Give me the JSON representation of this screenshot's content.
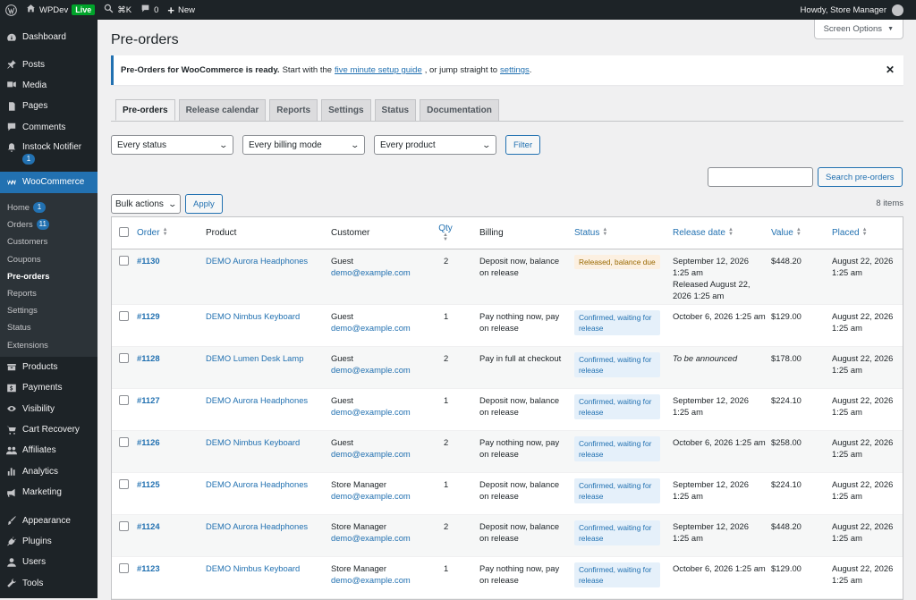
{
  "adminbar": {
    "site_name": "WPDev",
    "live_label": "Live",
    "search_shortcut": "⌘K",
    "comments_count": "0",
    "new_label": "New",
    "howdy": "Howdy, Store Manager"
  },
  "sidebar": {
    "top_items": [
      {
        "label": "Dashboard",
        "icon": "dashboard-icon"
      },
      {
        "label": "Posts",
        "icon": "pin-icon"
      },
      {
        "label": "Media",
        "icon": "media-icon"
      },
      {
        "label": "Pages",
        "icon": "pages-icon"
      },
      {
        "label": "Comments",
        "icon": "comments-icon"
      }
    ],
    "instock": {
      "label": "Instock Notifier",
      "badge": "1"
    },
    "woocommerce": {
      "label": "WooCommerce"
    },
    "sub_items": [
      {
        "label": "Home",
        "badge": "1"
      },
      {
        "label": "Orders",
        "badge": "11"
      },
      {
        "label": "Customers"
      },
      {
        "label": "Coupons"
      },
      {
        "label": "Pre-orders",
        "active": true
      },
      {
        "label": "Reports"
      },
      {
        "label": "Settings"
      },
      {
        "label": "Status"
      },
      {
        "label": "Extensions"
      }
    ],
    "bottom_items": [
      {
        "label": "Products"
      },
      {
        "label": "Payments"
      },
      {
        "label": "Visibility"
      },
      {
        "label": "Cart Recovery"
      },
      {
        "label": "Affiliates"
      },
      {
        "label": "Analytics"
      },
      {
        "label": "Marketing"
      },
      {
        "label": "Appearance"
      },
      {
        "label": "Plugins"
      },
      {
        "label": "Users"
      },
      {
        "label": "Tools"
      }
    ]
  },
  "screen_options": "Screen Options",
  "page_title": "Pre-orders",
  "notice": {
    "bold": "Pre-Orders for WooCommerce is ready.",
    "text1": "Start with the",
    "link1": "five minute setup guide",
    "text2": ", or jump straight to",
    "link2": "settings",
    "text3": "."
  },
  "tabs": [
    "Pre-orders",
    "Release calendar",
    "Reports",
    "Settings",
    "Status",
    "Documentation"
  ],
  "filters": {
    "status": "Every status",
    "billing": "Every billing mode",
    "product": "Every product",
    "filter_button": "Filter"
  },
  "search_button": "Search pre-orders",
  "bulk": {
    "label": "Bulk actions",
    "apply": "Apply"
  },
  "items_count": "8 items",
  "columns": {
    "order": "Order",
    "product": "Product",
    "customer": "Customer",
    "qty": "Qty",
    "billing": "Billing",
    "status": "Status",
    "release": "Release date",
    "value": "Value",
    "placed": "Placed"
  },
  "rows": [
    {
      "order": "#1130",
      "product": "DEMO Aurora Headphones",
      "customer": "Guest",
      "email": "demo@example.com",
      "qty": "2",
      "billing": "Deposit now, balance on release",
      "status": "Released, balance due",
      "status_type": "released",
      "release": "September 12, 2026 1:25 am",
      "release_note": "Released August 22, 2026 1:25 am",
      "value": "$448.20",
      "placed": "August 22, 2026 1:25 am"
    },
    {
      "order": "#1129",
      "product": "DEMO Nimbus Keyboard",
      "customer": "Guest",
      "email": "demo@example.com",
      "qty": "1",
      "billing": "Pay nothing now, pay on release",
      "status": "Confirmed, waiting for release",
      "status_type": "confirmed",
      "release": "October 6, 2026 1:25 am",
      "release_note": "",
      "value": "$129.00",
      "placed": "August 22, 2026 1:25 am"
    },
    {
      "order": "#1128",
      "product": "DEMO Lumen Desk Lamp",
      "customer": "Guest",
      "email": "demo@example.com",
      "qty": "2",
      "billing": "Pay in full at checkout",
      "status": "Confirmed, waiting for release",
      "status_type": "confirmed",
      "release": "To be announced",
      "release_note": "",
      "value": "$178.00",
      "placed": "August 22, 2026 1:25 am"
    },
    {
      "order": "#1127",
      "product": "DEMO Aurora Headphones",
      "customer": "Guest",
      "email": "demo@example.com",
      "qty": "1",
      "billing": "Deposit now, balance on release",
      "status": "Confirmed, waiting for release",
      "status_type": "confirmed",
      "release": "September 12, 2026 1:25 am",
      "release_note": "",
      "value": "$224.10",
      "placed": "August 22, 2026 1:25 am"
    },
    {
      "order": "#1126",
      "product": "DEMO Nimbus Keyboard",
      "customer": "Guest",
      "email": "demo@example.com",
      "qty": "2",
      "billing": "Pay nothing now, pay on release",
      "status": "Confirmed, waiting for release",
      "status_type": "confirmed",
      "release": "October 6, 2026 1:25 am",
      "release_note": "",
      "value": "$258.00",
      "placed": "August 22, 2026 1:25 am"
    },
    {
      "order": "#1125",
      "product": "DEMO Aurora Headphones",
      "customer": "Store Manager",
      "email": "demo@example.com",
      "qty": "1",
      "billing": "Deposit now, balance on release",
      "status": "Confirmed, waiting for release",
      "status_type": "confirmed",
      "release": "September 12, 2026 1:25 am",
      "release_note": "",
      "value": "$224.10",
      "placed": "August 22, 2026 1:25 am"
    },
    {
      "order": "#1124",
      "product": "DEMO Aurora Headphones",
      "customer": "Store Manager",
      "email": "demo@example.com",
      "qty": "2",
      "billing": "Deposit now, balance on release",
      "status": "Confirmed, waiting for release",
      "status_type": "confirmed",
      "release": "September 12, 2026 1:25 am",
      "release_note": "",
      "value": "$448.20",
      "placed": "August 22, 2026 1:25 am"
    },
    {
      "order": "#1123",
      "product": "DEMO Nimbus Keyboard",
      "customer": "Store Manager",
      "email": "demo@example.com",
      "qty": "1",
      "billing": "Pay nothing now, pay on release",
      "status": "Confirmed, waiting for release",
      "status_type": "confirmed",
      "release": "October 6, 2026 1:25 am",
      "release_note": "",
      "value": "$129.00",
      "placed": "August 22, 2026 1:25 am"
    }
  ],
  "colors": {
    "accent": "#2271b1",
    "sidebar": "#1d2327",
    "live": "#00a32a"
  }
}
